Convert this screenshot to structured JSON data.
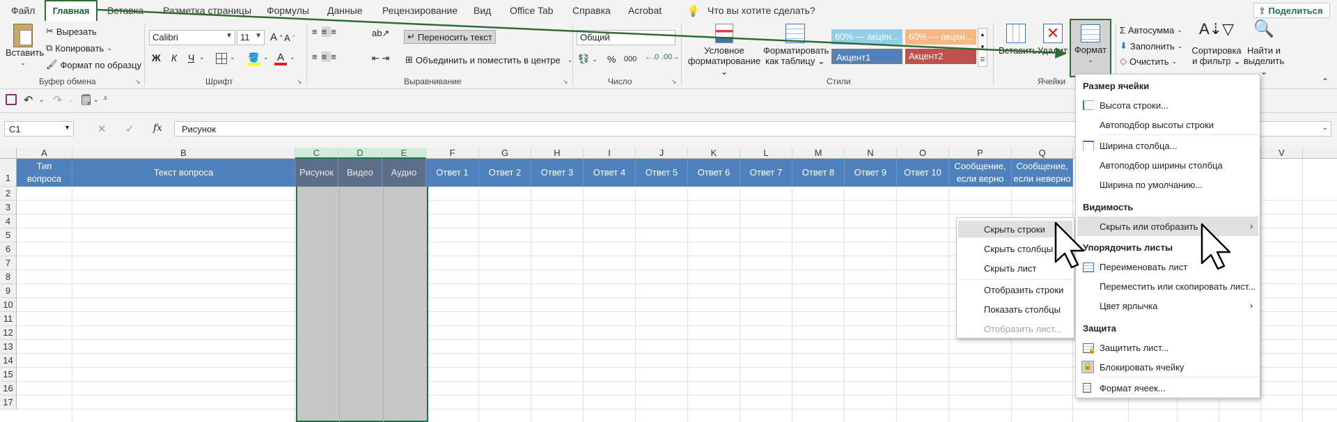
{
  "tabs": [
    "Файл",
    "Главная",
    "Вставка",
    "Разметка страницы",
    "Формулы",
    "Данные",
    "Рецензирование",
    "Вид",
    "Office Tab",
    "Справка",
    "Acrobat"
  ],
  "tell_me": "Что вы хотите сделать?",
  "share": "Поделиться",
  "clipboard": {
    "paste": "Вставить",
    "cut": "Вырезать",
    "copy": "Копировать",
    "format_painter": "Формат по образцу",
    "label": "Буфер обмена"
  },
  "font": {
    "name": "Calibri",
    "size": "11",
    "bold": "Ж",
    "italic": "К",
    "underline": "Ч",
    "label": "Шрифт"
  },
  "alignment": {
    "wrap": "Переносить текст",
    "merge": "Объединить и поместить в центре",
    "label": "Выравнивание"
  },
  "number": {
    "format": "Общий",
    "label": "Число",
    "percent": "%",
    "thousands": "000"
  },
  "styles": {
    "conditional": [
      "Условное",
      "форматирование"
    ],
    "as_table": [
      "Форматировать",
      "как таблицу"
    ],
    "cells": [
      "60% — акцен...",
      "60% — акцен...",
      "Акцент1",
      "Акцент2"
    ],
    "label": "Стили"
  },
  "cells_group": {
    "insert": "Вставить",
    "delete": "Удалить",
    "format": "Формат",
    "label": "Ячейки"
  },
  "editing": {
    "autosum": "Автосумма",
    "fill": "Заполнить",
    "clear": "Очистить",
    "sort": [
      "Сортировка",
      "и фильтр"
    ],
    "find": [
      "Найти и",
      "выделить"
    ]
  },
  "namebox": "C1",
  "formula": "Рисунок",
  "fx": "fx",
  "columns": [
    "A",
    "B",
    "C",
    "D",
    "E",
    "F",
    "G",
    "H",
    "I",
    "J",
    "K",
    "L",
    "M",
    "N",
    "O",
    "P",
    "Q",
    "V"
  ],
  "row1": {
    "A": [
      "Тип",
      "вопроса"
    ],
    "B": "Текст вопроса",
    "C": "Рисунок",
    "D": "Видео",
    "E": "Аудио",
    "F": "Ответ 1",
    "G": "Ответ 2",
    "H": "Ответ 3",
    "I": "Ответ 4",
    "J": "Ответ 5",
    "K": "Ответ 6",
    "L": "Ответ 7",
    "M": "Ответ 8",
    "N": "Ответ 9",
    "O": "Ответ 10",
    "P": [
      "Сообщение,",
      "если верно"
    ],
    "Q": [
      "Сообщение,",
      "если неверно"
    ]
  },
  "rows": [
    "1",
    "2",
    "3",
    "4",
    "5",
    "6",
    "7",
    "8",
    "9",
    "10",
    "11",
    "12",
    "13",
    "14",
    "15",
    "16",
    "17"
  ],
  "format_menu": {
    "h_size": "Размер ячейки",
    "row_height": "Высота строки...",
    "autofit_row": "Автоподбор высоты строки",
    "col_width": "Ширина столбца...",
    "autofit_col": "Автоподбор ширины столбца",
    "default_width": "Ширина по умолчанию...",
    "h_visibility": "Видимость",
    "hide_show": "Скрыть или отобразить",
    "h_organize": "Упорядочить листы",
    "rename": "Переименовать лист",
    "move_copy": "Переместить или скопировать лист...",
    "tab_color": "Цвет ярлычка",
    "h_protect": "Защита",
    "protect_sheet": "Защитить лист...",
    "lock_cell": "Блокировать ячейку",
    "format_cells": "Формат ячеек..."
  },
  "hide_menu": {
    "hide_rows": "Скрыть строки",
    "hide_cols": "Скрыть столбцы",
    "hide_sheet": "Скрыть лист",
    "show_rows": "Отобразить строки",
    "show_cols": "Показать столбцы",
    "show_sheet": "Отобразить лист..."
  }
}
